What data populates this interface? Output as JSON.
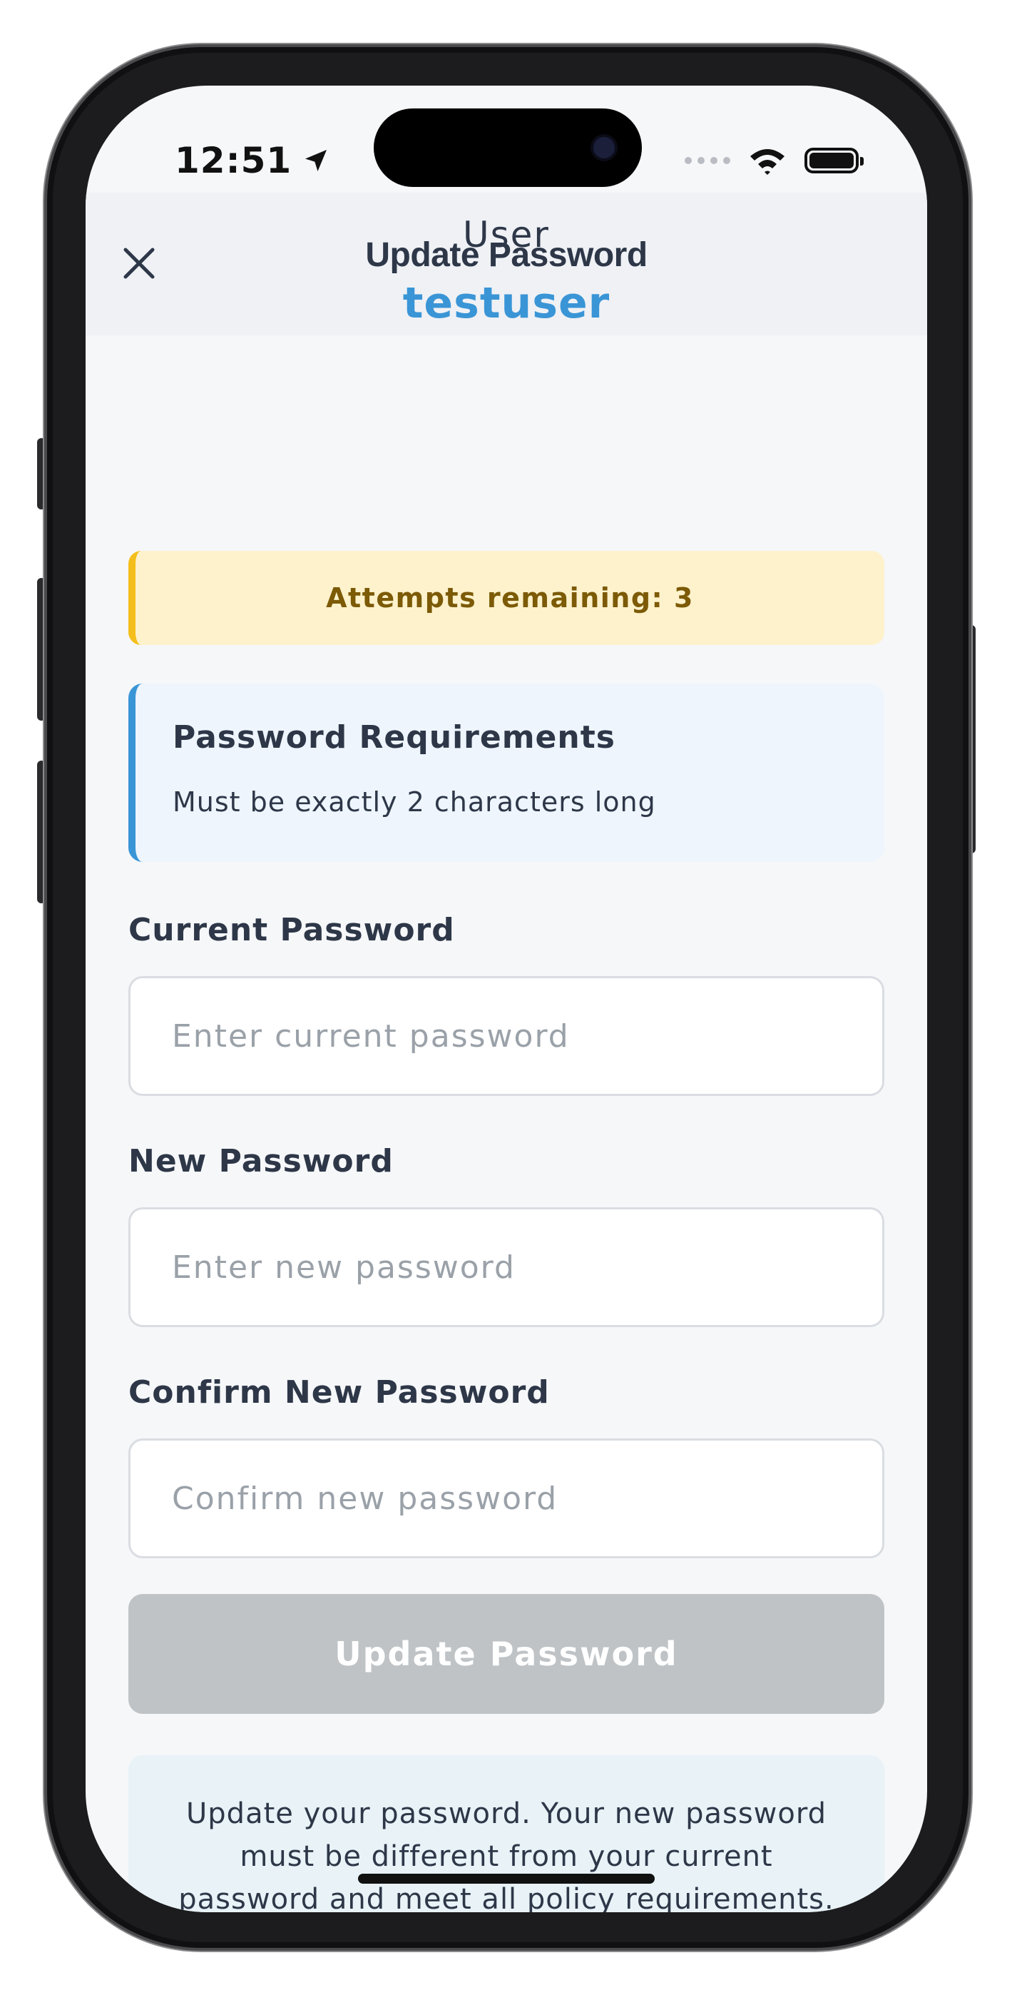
{
  "status_bar": {
    "time": "12:51"
  },
  "header": {
    "title": "Update Password"
  },
  "user": {
    "caption": "User",
    "username": "testuser"
  },
  "attempts": {
    "text": "Attempts remaining: 3"
  },
  "requirements": {
    "title": "Password Requirements",
    "text": "Must be exactly 2 characters long"
  },
  "fields": {
    "current": {
      "label": "Current Password",
      "placeholder": "Enter current password",
      "value": ""
    },
    "new": {
      "label": "New Password",
      "placeholder": "Enter new password",
      "value": ""
    },
    "confirm": {
      "label": "Confirm New Password",
      "placeholder": "Confirm new password",
      "value": ""
    }
  },
  "submit": {
    "label": "Update Password"
  },
  "info": {
    "text": "Update your password. Your new password must be different from your current password and meet all policy requirements."
  },
  "colors": {
    "accent": "#3a95d6",
    "warning_bg": "#fdf2cc",
    "warning_border": "#f4bf1c",
    "button_disabled": "#bfc3c6"
  }
}
